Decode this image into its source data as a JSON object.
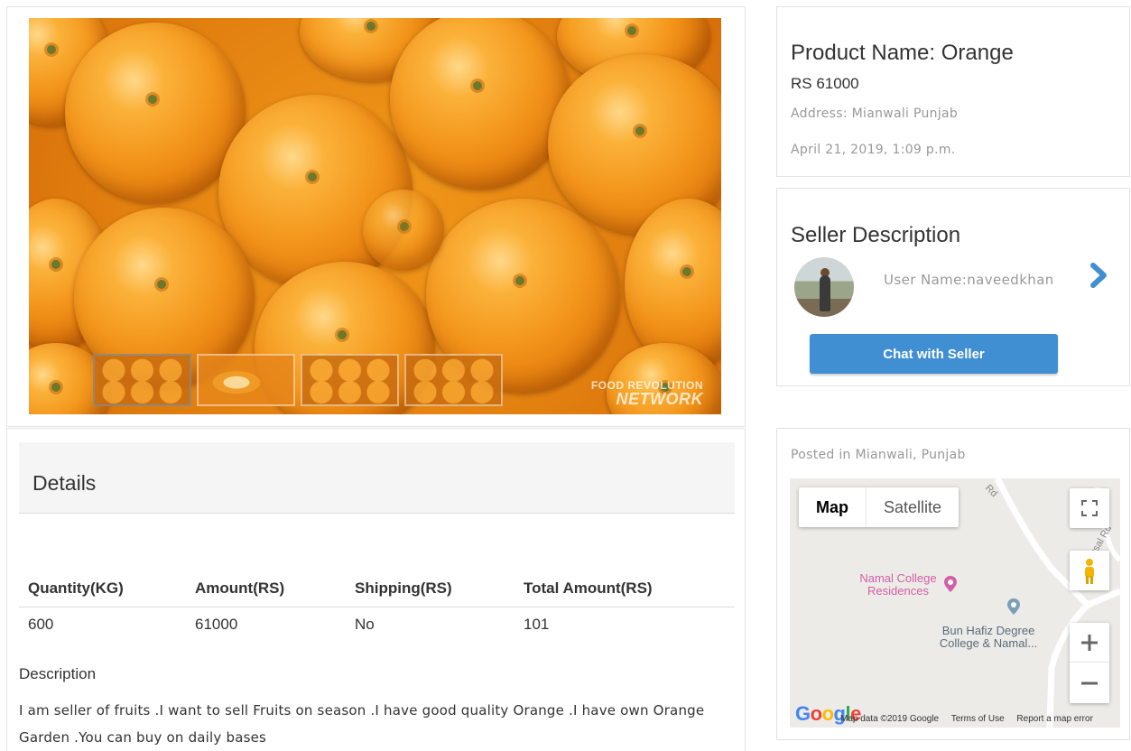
{
  "gallery": {
    "main_image_alt": "Oranges",
    "watermark_line1": "FOOD REVOLUTION",
    "watermark_line2": "NETWORK",
    "thumbnails": [
      "orange-thumb-1",
      "orange-thumb-2",
      "orange-thumb-3",
      "orange-thumb-4"
    ]
  },
  "details": {
    "title": "Details",
    "table": {
      "headers": [
        "Quantity(KG)",
        "Amount(RS)",
        "Shipping(RS)",
        "Total Amount(RS)"
      ],
      "rows": [
        [
          "600",
          "61000",
          "No",
          "101"
        ]
      ]
    },
    "description_label": "Description",
    "description_text": "I am seller of fruits .I want to sell Fruits on season .I have good quality Orange .I have own Orange Garden .You can buy on daily bases"
  },
  "product": {
    "name": "Product Name: Orange",
    "price": "RS 61000",
    "address": "Address: Mianwali Punjab",
    "date": "April 21, 2019, 1:09 p.m."
  },
  "seller": {
    "title": "Seller Description",
    "username": "User Name:naveedkhan",
    "chat_button": "Chat with Seller",
    "arrow_icon": "chevron-right-icon"
  },
  "map": {
    "posted_in": "Posted in Mianwali, Punjab",
    "type_map": "Map",
    "type_satellite": "Satellite",
    "poi_namal_line1": "Namal College",
    "poi_namal_line2": "Residences",
    "poi_bun_line1": "Bun Hafiz Degree",
    "poi_bun_line2": "College & Namal...",
    "road_label_1": "Rd",
    "road_label_2": "rsal Rd",
    "google_logo": "Google",
    "footer_data": "Map data ©2019 Google",
    "footer_terms": "Terms of Use",
    "footer_report": "Report a map error",
    "colors": {
      "poi_pink": "#d35ea6",
      "pin_blue": "#7aa0b8",
      "pegman": "#f6b400"
    }
  },
  "colors": {
    "accent_button": "#3f8fd2",
    "arrow": "#3f8fd2",
    "muted_text": "#999999",
    "header_bg": "#f5f5f5"
  }
}
